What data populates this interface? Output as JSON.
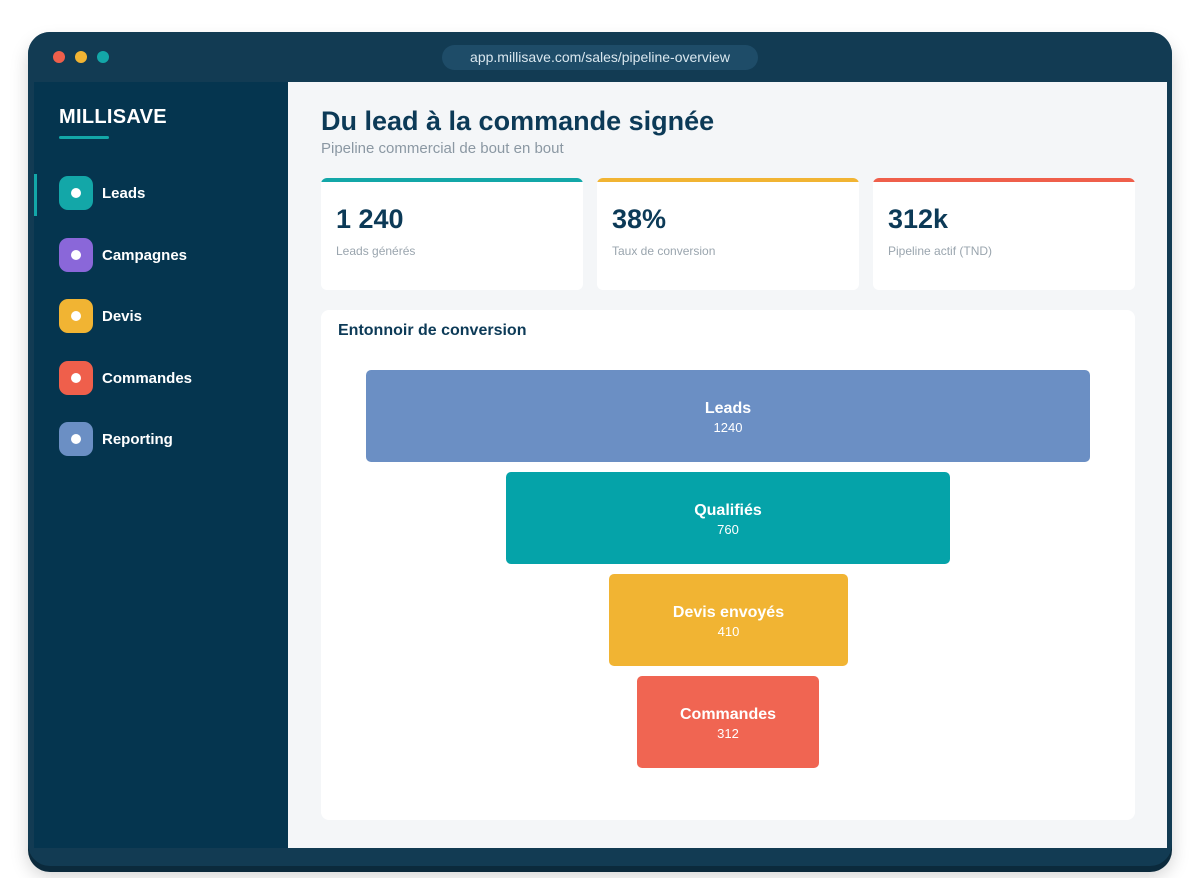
{
  "browser": {
    "url": "app.millisave.com/sales/pipeline-overview",
    "dots": [
      "#ef5f4b",
      "#f1b433",
      "#13a7a8"
    ]
  },
  "sidebar": {
    "brand": "MILLISAVE",
    "items": [
      {
        "label": "Leads",
        "color": "#13a7a8",
        "active": true
      },
      {
        "label": "Campagnes",
        "color": "#8a67d9",
        "active": false
      },
      {
        "label": "Devis",
        "color": "#f1b433",
        "active": false
      },
      {
        "label": "Commandes",
        "color": "#ef5f4b",
        "active": false
      },
      {
        "label": "Reporting",
        "color": "#6b8fc4",
        "active": false
      }
    ]
  },
  "header": {
    "title": "Du lead à la commande signée",
    "subtitle": "Pipeline commercial de bout en bout"
  },
  "kpis": [
    {
      "value": "1 240",
      "label": "Leads générés",
      "color": "#13a7a8"
    },
    {
      "value": "38%",
      "label": "Taux de conversion",
      "color": "#f1b433"
    },
    {
      "value": "312k",
      "label": "Pipeline actif (TND)",
      "color": "#ef5f4b"
    }
  ],
  "funnel": {
    "title": "Entonnoir de conversion"
  },
  "chart_data": {
    "type": "bar",
    "orientation": "funnel",
    "categories": [
      "Leads",
      "Qualifiés",
      "Devis envoyés",
      "Commandes"
    ],
    "values": [
      1240,
      760,
      410,
      312
    ],
    "colors": [
      "#6b8fc4",
      "#05a3a9",
      "#f1b433",
      "#f06552"
    ]
  }
}
